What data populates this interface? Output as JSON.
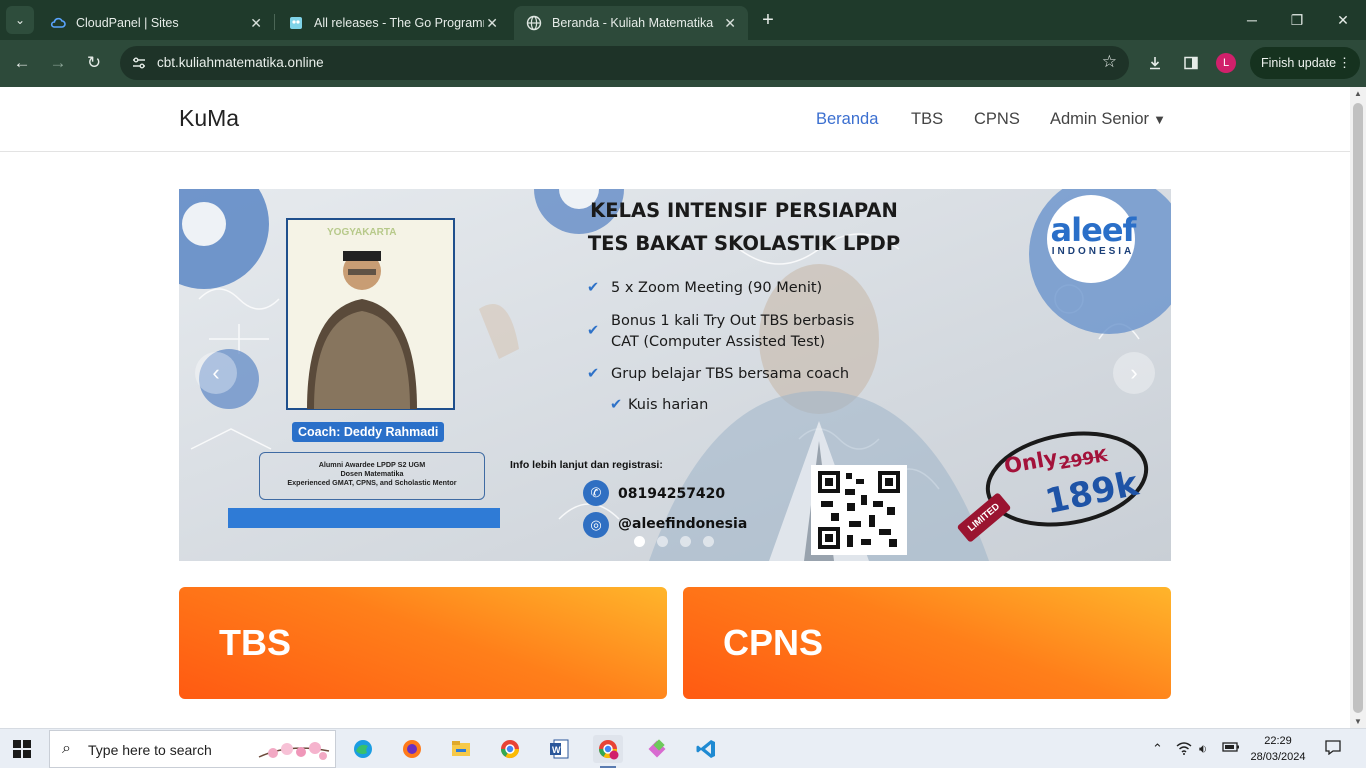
{
  "browser": {
    "tabs": [
      {
        "title": "CloudPanel | Sites",
        "active": false
      },
      {
        "title": "All releases - The Go Programming Language",
        "active": false
      },
      {
        "title": "Beranda - Kuliah Matematika",
        "active": true
      }
    ],
    "url": "cbt.kuliahmatematika.online",
    "profile_initial": "L",
    "finish_update_label": "Finish update"
  },
  "site": {
    "brand": "KuMa",
    "nav": {
      "beranda": "Beranda",
      "tbs": "TBS",
      "cpns": "CPNS",
      "admin": "Admin Senior"
    },
    "accent": "#3b6fd0"
  },
  "banner": {
    "title_line1": "KELAS INTENSIF PERSIAPAN",
    "title_line2": "TES BAKAT SKOLASTIK LPDP",
    "features": [
      "5 x Zoom Meeting (90 Menit)",
      "Bonus 1 kali Try Out TBS berbasis",
      "CAT (Computer Assisted Test)",
      "Grup belajar TBS bersama coach",
      "Kuis harian"
    ],
    "photo_caption": "YOGYAKARTA",
    "coach": "Coach: Deddy Rahmadi",
    "coach_desc": [
      "Alumni Awardee LPDP S2 UGM",
      "Dosen Matematika",
      "Experienced GMAT, CPNS, and Scholastic Mentor"
    ],
    "info": "Info lebih lanjut dan registrasi:",
    "phone": "08194257420",
    "instagram": "@aleefindonesia",
    "logo_main": "aleef",
    "logo_sub": "INDONESIA",
    "price_only": "Only",
    "price_old": "299K",
    "price_new": "189k",
    "limited": "LIMITED",
    "slide_count": 4,
    "active_slide": 1
  },
  "cards": [
    {
      "title": "TBS"
    },
    {
      "title": "CPNS"
    }
  ],
  "taskbar": {
    "search_placeholder": "Type here to search",
    "time": "22:29",
    "date": "28/03/2024",
    "apps": [
      "edge-icon",
      "firefox-icon",
      "file-explorer-icon",
      "chrome-icon",
      "word-icon",
      "chrome-profile-icon",
      "git-icon",
      "vscode-icon"
    ]
  }
}
